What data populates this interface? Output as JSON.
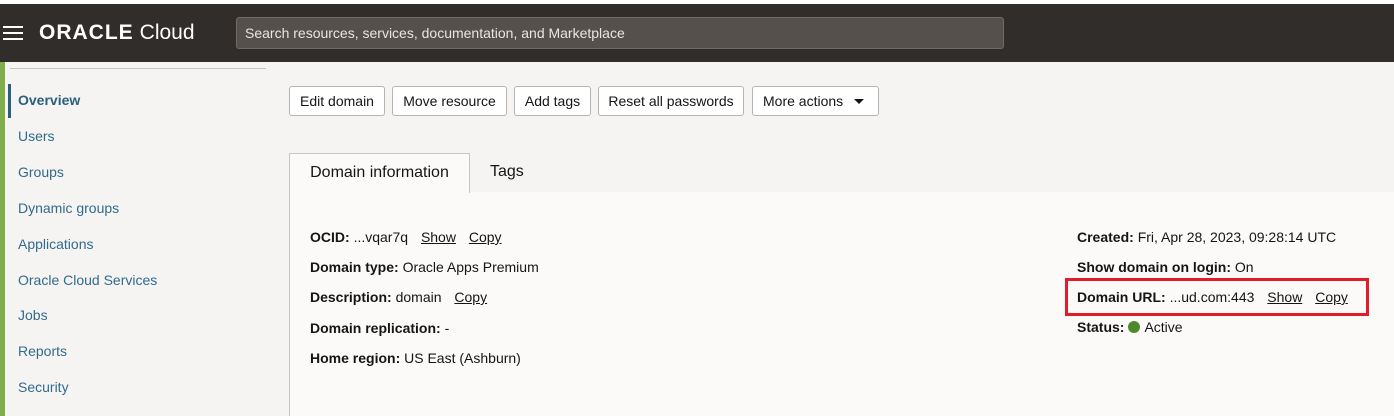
{
  "header": {
    "brand": "ORACLE",
    "product": "Cloud",
    "search_placeholder": "Search resources, services, documentation, and Marketplace"
  },
  "sidebar": {
    "items": [
      {
        "label": "Overview",
        "active": true
      },
      {
        "label": "Users"
      },
      {
        "label": "Groups"
      },
      {
        "label": "Dynamic groups"
      },
      {
        "label": "Applications"
      },
      {
        "label": "Oracle Cloud Services"
      },
      {
        "label": "Jobs"
      },
      {
        "label": "Reports"
      },
      {
        "label": "Security"
      }
    ]
  },
  "actions": {
    "edit": "Edit domain",
    "move": "Move resource",
    "tags": "Add tags",
    "reset": "Reset all passwords",
    "more": "More actions"
  },
  "tabs": {
    "info": "Domain information",
    "tags": "Tags"
  },
  "info": {
    "ocid": {
      "label": "OCID:",
      "value": "...vqar7q",
      "show": "Show",
      "copy": "Copy"
    },
    "domain_type": {
      "label": "Domain type:",
      "value": "Oracle Apps Premium"
    },
    "description": {
      "label": "Description:",
      "value": "domain",
      "copy": "Copy"
    },
    "replication": {
      "label": "Domain replication:",
      "value": "-"
    },
    "home_region": {
      "label": "Home region:",
      "value": "US East (Ashburn)"
    },
    "created": {
      "label": "Created:",
      "value": "Fri, Apr 28, 2023, 09:28:14 UTC"
    },
    "show_on_login": {
      "label": "Show domain on login:",
      "value": "On"
    },
    "domain_url": {
      "label": "Domain URL:",
      "value": "...ud.com:443",
      "show": "Show",
      "copy": "Copy"
    },
    "status": {
      "label": "Status:",
      "value": "Active",
      "color": "#4d8a2e"
    }
  },
  "colors": {
    "topbar": "#312d2a",
    "accent": "#7fae4b",
    "link": "#316b8c",
    "highlight": "#e11d2a"
  }
}
